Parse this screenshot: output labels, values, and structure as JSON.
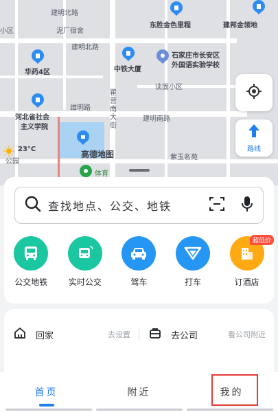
{
  "map": {
    "labels": [
      "建明北路",
      "泥厂宿舍",
      "东胜金色里程",
      "建邦金领地",
      "小区",
      "建明北路",
      "华药4区",
      "中铁大厦",
      "石家庄市长安区",
      "外国语实验学校",
      "谈固小区",
      "河北省社会",
      "主义学院",
      "维明路",
      "瞿营南大街",
      "建明南路",
      "23°C",
      "公园",
      "高德地图",
      "紫玉名苑",
      "体育"
    ],
    "weather": "23°C",
    "watermark": "高德地图",
    "locate_icon": "locate-icon",
    "route_label": "路线"
  },
  "search": {
    "placeholder": "查找地点、公交、地铁"
  },
  "shortcuts": [
    {
      "label": "公交地铁",
      "icon": "bus-icon",
      "color": "#1bc7a0"
    },
    {
      "label": "实时公交",
      "icon": "realtime-bus-icon",
      "color": "#1bc7a0"
    },
    {
      "label": "驾车",
      "icon": "car-icon",
      "color": "#2596f3"
    },
    {
      "label": "打车",
      "icon": "taxi-icon",
      "color": "#2596f3"
    },
    {
      "label": "订酒店",
      "icon": "hotel-icon",
      "color": "#ffaa12",
      "badge": "超低价"
    }
  ],
  "places": {
    "home": {
      "label": "回家",
      "hint": "去设置"
    },
    "company": {
      "label": "去公司",
      "hint": "看公司附近"
    }
  },
  "tabs": [
    {
      "label": "首页",
      "active": true
    },
    {
      "label": "附近",
      "active": false
    },
    {
      "label": "我的",
      "active": false
    }
  ],
  "colors": {
    "accent": "#1f7df0",
    "highlight": "#e53935"
  }
}
